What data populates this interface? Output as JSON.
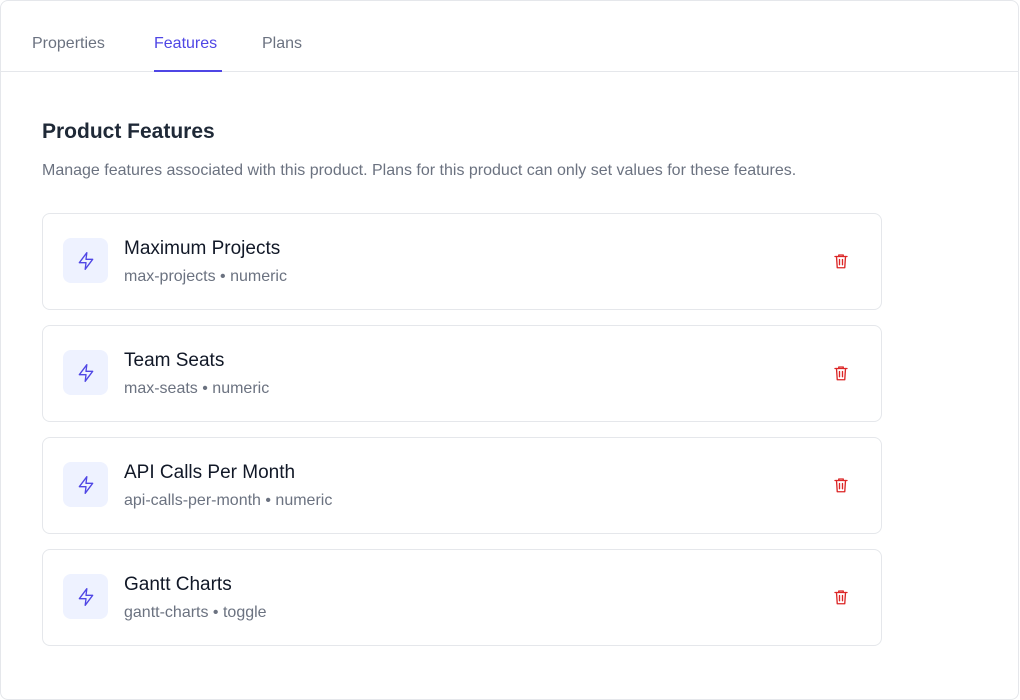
{
  "tabs": [
    {
      "label": "Properties",
      "active": false
    },
    {
      "label": "Features",
      "active": true
    },
    {
      "label": "Plans",
      "active": false
    }
  ],
  "section": {
    "title": "Product Features",
    "description": "Manage features associated with this product. Plans for this product can only set values for these features."
  },
  "features": [
    {
      "name": "Maximum Projects",
      "key": "max-projects",
      "type": "numeric",
      "subtitle": "max-projects • numeric",
      "icon": "lightning-icon"
    },
    {
      "name": "Team Seats",
      "key": "max-seats",
      "type": "numeric",
      "subtitle": "max-seats • numeric",
      "icon": "lightning-icon"
    },
    {
      "name": "API Calls Per Month",
      "key": "api-calls-per-month",
      "type": "numeric",
      "subtitle": "api-calls-per-month • numeric",
      "icon": "lightning-icon"
    },
    {
      "name": "Gantt Charts",
      "key": "gantt-charts",
      "type": "toggle",
      "subtitle": "gantt-charts • toggle",
      "icon": "lightning-icon"
    }
  ],
  "colors": {
    "accent": "#4f46e5",
    "icon_bg": "#eef2ff",
    "danger": "#dc2626",
    "muted_text": "#6b7280",
    "border": "#e5e7eb"
  }
}
